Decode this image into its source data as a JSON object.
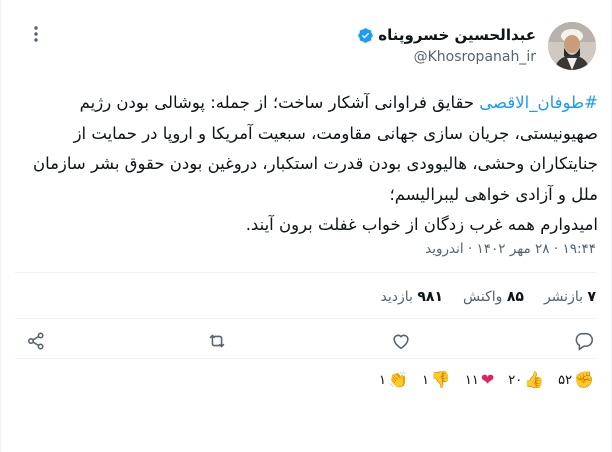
{
  "author": {
    "display_name": "عبدالحسین خسروپناه",
    "handle": "@Khosropanah_ir",
    "verified": true,
    "badge_color": "#1d9bf0"
  },
  "tweet": {
    "hashtag": "#طوفان_الاقصی",
    "body": " حقایق فراوانی آشکار ساخت؛ از جمله: پوشالی بودن رژیم صهیونیستی، جریان سازی جهانی مقاومت، سبعیت آمریکا و اروپا در حمایت از جنایتکاران وحشی، هالیوودی بودن قدرت استکبار، دروغین بودن حقوق بشر سازمان ملل و آزادی خواهی لیبرالیسم؛\nامیدوارم همه غرب زدگان از خواب غفلت برون آیند.",
    "hashtag_color": "#1d9bf0"
  },
  "timestamp": "۱۹:۴۴ · ۲۸ مهر ۱۴۰۲ · اندروید",
  "stats": {
    "reposts_num": "۷",
    "reposts_label": "بازنشر",
    "reactions_num": "۸۵",
    "reactions_label": "واکنش",
    "views_num": "۹۸۱",
    "views_label": "بازدید"
  },
  "actions": [
    "reply-icon",
    "repost-icon",
    "like-icon",
    "share-icon"
  ],
  "reaction_chips": [
    {
      "icon": "fist-icon",
      "emoji": "✊",
      "count": "۵۲"
    },
    {
      "icon": "thumbs-up-icon",
      "emoji": "👍",
      "count": "۲۰"
    },
    {
      "icon": "heart-icon",
      "emoji": "❤",
      "count": "۱۱"
    },
    {
      "icon": "thumbs-down-icon",
      "emoji": "👎",
      "count": "۱"
    },
    {
      "icon": "clap-icon",
      "emoji": "👏",
      "count": "۱"
    }
  ]
}
